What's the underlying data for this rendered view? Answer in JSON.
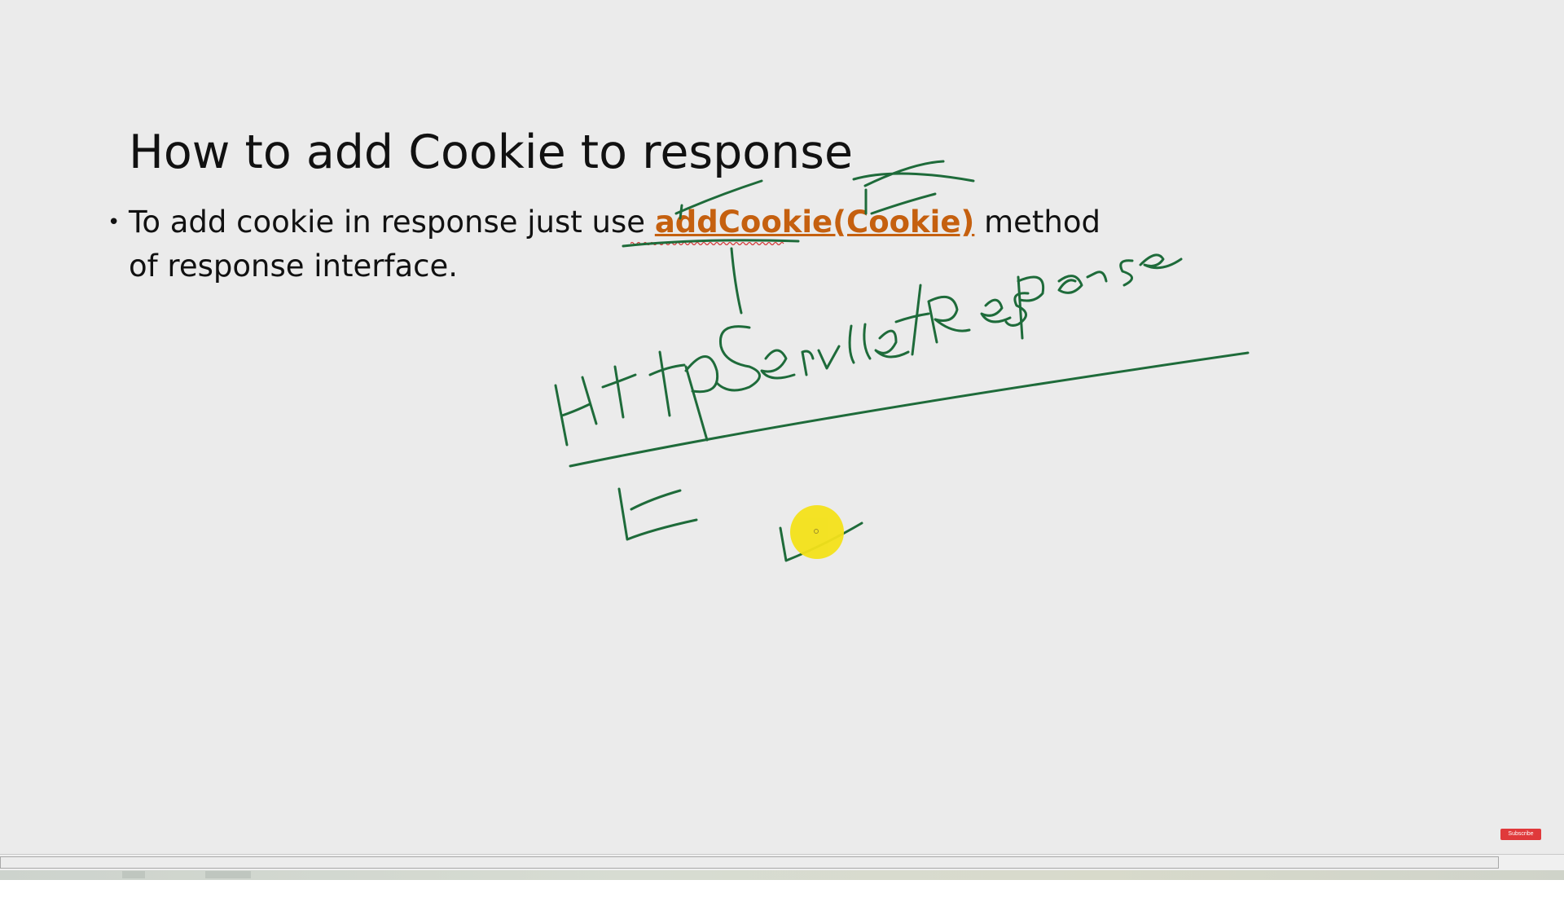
{
  "slide": {
    "title": "How to add Cookie to response",
    "bullet": {
      "marker": "•",
      "text_before": "To add cookie in response just use ",
      "method": "addCookie(Cookie)",
      "text_after": " method of response interface."
    }
  },
  "annotation": {
    "handwritten_text": "HttpServletResponse"
  },
  "colors": {
    "slide_background": "#ebebeb",
    "method_highlight": "#c5600f",
    "ink": "#1e6b3a",
    "laser_pointer": "#f4e21a",
    "subscribe_badge": "#e0393b"
  },
  "overlay": {
    "subscribe_label": "Subscribe"
  }
}
